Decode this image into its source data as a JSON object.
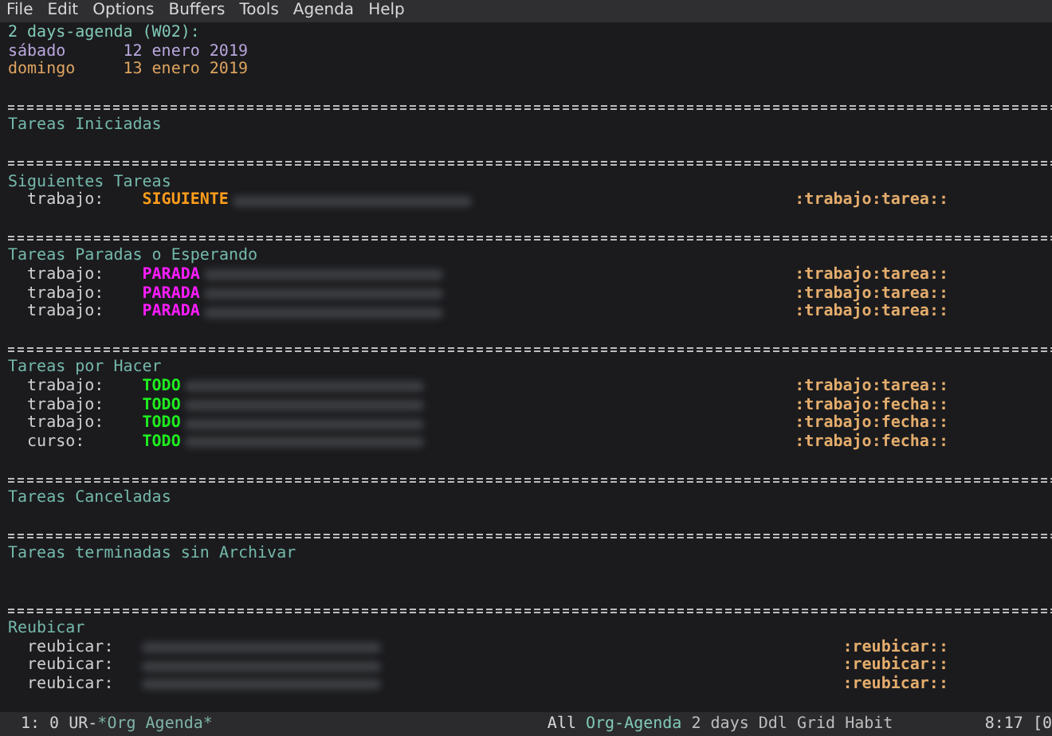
{
  "menu": [
    "File",
    "Edit",
    "Options",
    "Buffers",
    "Tools",
    "Agenda",
    "Help"
  ],
  "header": "2 days-agenda (W02):",
  "days": [
    {
      "weekday": "sábado",
      "day": "12",
      "month_year": "enero 2019",
      "today": false
    },
    {
      "weekday": "domingo",
      "day": "13",
      "month_year": "enero 2019",
      "today": true
    }
  ],
  "sections": [
    {
      "title": "Tareas Iniciadas"
    },
    {
      "title": "Siguientes Tareas",
      "items": [
        {
          "category": "trabajo:",
          "keyword": "SIGUIENTE",
          "kind": "next",
          "tags": ":trabajo:tarea::"
        }
      ]
    },
    {
      "title": "Tareas Paradas o Esperando",
      "items": [
        {
          "category": "trabajo:",
          "keyword": "PARADA",
          "kind": "waiting",
          "tags": ":trabajo:tarea::"
        },
        {
          "category": "trabajo:",
          "keyword": "PARADA",
          "kind": "waiting",
          "tags": ":trabajo:tarea::"
        },
        {
          "category": "trabajo:",
          "keyword": "PARADA",
          "kind": "waiting",
          "tags": ":trabajo:tarea::"
        }
      ]
    },
    {
      "title": "Tareas por Hacer",
      "items": [
        {
          "category": "trabajo:",
          "keyword": "TODO",
          "kind": "todo",
          "tags": ":trabajo:tarea::"
        },
        {
          "category": "trabajo:",
          "keyword": "TODO",
          "kind": "todo",
          "tags": ":trabajo:fecha::"
        },
        {
          "category": "trabajo:",
          "keyword": "TODO",
          "kind": "todo",
          "tags": ":trabajo:fecha::"
        },
        {
          "category": "curso:",
          "keyword": "TODO",
          "kind": "todo",
          "tags": ":trabajo:fecha::"
        }
      ]
    },
    {
      "title": "Tareas Canceladas"
    },
    {
      "title": "Tareas terminadas sin Archivar",
      "gap": true
    },
    {
      "title": "Reubicar",
      "items": [
        {
          "category": "reubicar:",
          "kind": "refile",
          "tags": ":reubicar::"
        },
        {
          "category": "reubicar:",
          "kind": "refile",
          "tags": ":reubicar::"
        },
        {
          "category": "reubicar:",
          "kind": "refile",
          "tags": ":reubicar::"
        }
      ]
    }
  ],
  "status_bar": {
    "position": "1: 0 UR-",
    "buffer": "*Org Agenda*",
    "scroll": "All",
    "mode": "Org-Agenda",
    "minor_modes": "2 days Ddl Grid Habit",
    "clock": "8:17 [0"
  }
}
